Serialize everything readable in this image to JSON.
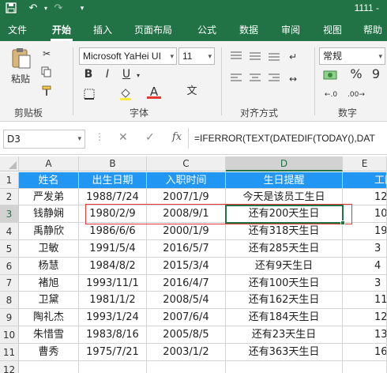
{
  "title": "1111 -",
  "tabs": [
    "文件",
    "开始",
    "插入",
    "页面布局",
    "公式",
    "数据",
    "审阅",
    "视图",
    "帮助"
  ],
  "ribbon": {
    "paste_label": "粘贴",
    "clipboard_label": "剪贴板",
    "font_label": "字体",
    "align_label": "对齐方式",
    "number_label": "数字",
    "font_name": "Microsoft YaHei UI",
    "font_size": "11",
    "number_format": "常规",
    "bold": "B",
    "italic": "I",
    "underline": "U",
    "wen": "文",
    "percent": "%",
    "comma": "9"
  },
  "formula_bar": {
    "name_box": "D3",
    "fx": "fx",
    "formula": "=IFERROR(TEXT(DATEDIF(TODAY(),DAT"
  },
  "columns": [
    "A",
    "B",
    "C",
    "D",
    "E"
  ],
  "rows": [
    "1",
    "2",
    "3",
    "4",
    "5",
    "6",
    "7",
    "8",
    "9",
    "10",
    "11",
    "12"
  ],
  "header": [
    "姓名",
    "出生日期",
    "入职时间",
    "生日提醒",
    "工龄"
  ],
  "data": [
    [
      "严发弟",
      "1988/7/24",
      "2007/1/9",
      "今天是该员工生日",
      "12"
    ],
    [
      "钱静娴",
      "1980/2/9",
      "2008/9/1",
      "还有200天生日",
      "10"
    ],
    [
      "禹静欣",
      "1986/6/6",
      "2000/1/9",
      "还有318天生日",
      "19"
    ],
    [
      "卫敏",
      "1991/5/4",
      "2016/5/7",
      "还有285天生日",
      "3"
    ],
    [
      "杨慧",
      "1984/8/2",
      "2015/3/4",
      "还有9天生日",
      "4"
    ],
    [
      "褚旭",
      "1993/11/1",
      "2016/4/7",
      "还有100天生日",
      "3"
    ],
    [
      "卫黛",
      "1981/1/2",
      "2008/5/4",
      "还有162天生日",
      "11"
    ],
    [
      "陶礼杰",
      "1993/1/24",
      "2007/6/4",
      "还有184天生日",
      "12"
    ],
    [
      "朱惜雪",
      "1983/8/16",
      "2005/8/5",
      "还有23天生日",
      "13"
    ],
    [
      "曹秀",
      "1975/7/21",
      "2003/1/2",
      "还有363天生日",
      "16"
    ]
  ],
  "colors": {
    "accent": "#217346",
    "header_fill": "#2196f3",
    "highlight": "#e53935"
  }
}
